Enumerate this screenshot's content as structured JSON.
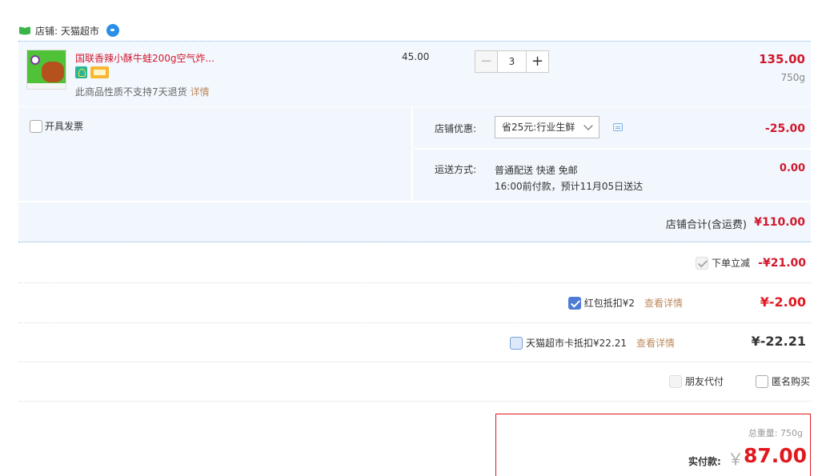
{
  "shop": {
    "label": "店铺: 天猫超市"
  },
  "item": {
    "name": "国联香辣小酥牛蛙200g空气炸...",
    "return_note": "此商品性质不支持7天退货",
    "return_link": "详情",
    "unit_price": "45.00",
    "qty_minus": "−",
    "qty": "3",
    "qty_plus": "+",
    "line_total": "135.00",
    "weight": "750g"
  },
  "invoice": {
    "label": "开具发票"
  },
  "shop_discount": {
    "label": "店铺优惠:",
    "selected": "省25元:行业生鲜",
    "amount": "-25.00"
  },
  "shipping": {
    "label": "运送方式:",
    "line1": "普通配送 快递 免邮",
    "line2": "16:00前付款，预计11月05日送达",
    "amount": "0.00"
  },
  "subtotal": {
    "label": "店铺合计(含运费)",
    "amount": "¥110.00"
  },
  "options": {
    "instant_discount": {
      "label": "下单立减",
      "amount": "-¥21.00"
    },
    "red_packet": {
      "label": "红包抵扣¥2",
      "link": "查看详情",
      "amount": "¥-2.00"
    },
    "supermarket_card": {
      "label": "天猫超市卡抵扣¥22.21",
      "link": "查看详情",
      "amount": "¥-22.21"
    },
    "friend_pay": {
      "label": "朋友代付"
    },
    "anonymous": {
      "label": "匿名购买"
    }
  },
  "payment": {
    "total_weight": "总重量: 750g",
    "label": "实付款:",
    "currency": "￥",
    "amount": "87.00"
  },
  "colors": {
    "price_red": "#d1182d",
    "link_brown": "#bd8a5b",
    "panel_blue": "#f2f7fd",
    "check_blue": "#4d7bd6"
  }
}
